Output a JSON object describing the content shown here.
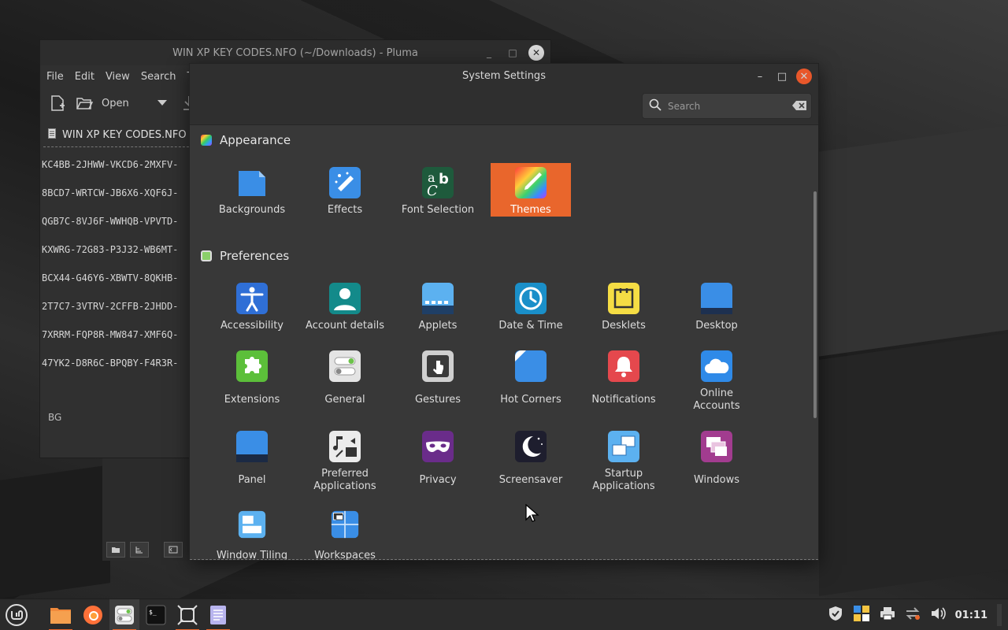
{
  "pluma": {
    "title": "WIN XP KEY CODES.NFO (~/Downloads) - Pluma",
    "menu": [
      "File",
      "Edit",
      "View",
      "Search",
      "T"
    ],
    "toolbar": {
      "open_label": "Open"
    },
    "tab_label": "WIN XP KEY CODES.NFO",
    "lines": [
      "KC4BB-2JHWW-VKCD6-2MXFV-",
      "8BCD7-WRTCW-JB6X6-XQF6J-",
      "QGB7C-8VJ6F-WWHQB-VPVTD-",
      "KXWRG-72G83-P3J32-WB6MT-",
      "BCX44-G46Y6-XBWTV-8QKHB-",
      "2T7C7-3VTRV-2CFFB-2JHDD-",
      "7XRRM-FQP8R-MW847-XMF6Q-",
      "47YK2-D8R6C-BPQBY-F4R3R-"
    ],
    "bg_label": "BG"
  },
  "settings": {
    "title": "System Settings",
    "search": {
      "placeholder": "Search",
      "value": ""
    },
    "sections": {
      "appearance": "Appearance",
      "preferences": "Preferences"
    },
    "appearance_items": [
      {
        "label": "Backgrounds",
        "icon": "backgrounds-icon"
      },
      {
        "label": "Effects",
        "icon": "effects-icon"
      },
      {
        "label": "Font Selection",
        "icon": "font-selection-icon"
      },
      {
        "label": "Themes",
        "icon": "themes-icon",
        "selected": true
      }
    ],
    "preferences_items": [
      {
        "label": "Accessibility"
      },
      {
        "label": "Account details"
      },
      {
        "label": "Applets"
      },
      {
        "label": "Date & Time"
      },
      {
        "label": "Desklets"
      },
      {
        "label": "Desktop"
      },
      {
        "label": "Extensions"
      },
      {
        "label": "General"
      },
      {
        "label": "Gestures"
      },
      {
        "label": "Hot Corners"
      },
      {
        "label": "Notifications"
      },
      {
        "label": "Online\nAccounts"
      },
      {
        "label": "Panel"
      },
      {
        "label": "Preferred\nApplications"
      },
      {
        "label": "Privacy"
      },
      {
        "label": "Screensaver"
      },
      {
        "label": "Startup\nApplications"
      },
      {
        "label": "Windows"
      },
      {
        "label": "Window Tiling"
      },
      {
        "label": "Workspaces"
      }
    ]
  },
  "taskbar": {
    "clock": "01:11",
    "apps": [
      "menu-icon",
      "files-icon",
      "firefox-icon",
      "settings-icon",
      "terminal-icon",
      "screenshot-icon",
      "text-editor-icon"
    ]
  },
  "colors": {
    "accent": "#e9662c",
    "window_bg": "#383838",
    "header_bg": "#2f2f2f"
  }
}
